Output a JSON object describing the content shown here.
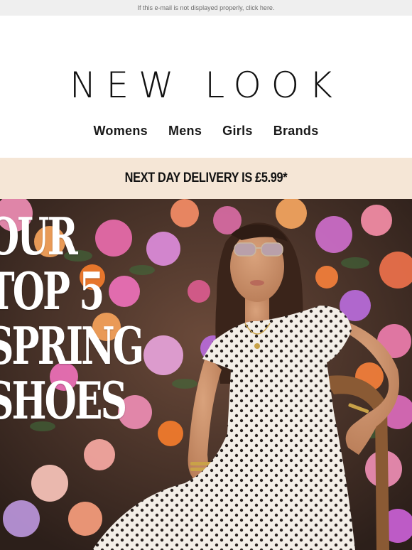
{
  "preheader": {
    "text": "If this e-mail is not displayed properly, click here."
  },
  "brand": {
    "logo_text": "NEW LOOK"
  },
  "nav": [
    {
      "label": "Womens"
    },
    {
      "label": "Mens"
    },
    {
      "label": "Girls"
    },
    {
      "label": "Brands"
    }
  ],
  "banner": {
    "text": "NEXT DAY DELIVERY IS £5.99*"
  },
  "hero": {
    "title_lines": [
      "OUR",
      "TOP 5",
      "SPRING",
      "SHOES"
    ]
  },
  "colors": {
    "preheader_bg": "#efefef",
    "banner_bg": "#f5e6d6",
    "text_dark": "#111111",
    "hero_text": "#ffffff"
  }
}
